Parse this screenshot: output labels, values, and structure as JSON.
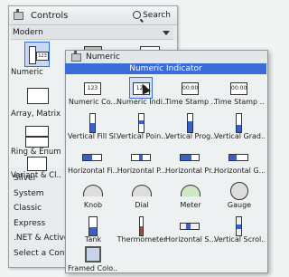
{
  "controls_palette": {
    "title": "Controls",
    "search_label": "Search",
    "category": "Modern",
    "items": [
      {
        "label": "Numeric",
        "icon": "numeric-icon"
      },
      {
        "label": "",
        "icon": "boolean-icon"
      },
      {
        "label": "",
        "icon": "string-icon"
      },
      {
        "label": "Array, Matrix...",
        "icon": "array-icon"
      },
      {
        "label": "Ring & Enum",
        "icon": "ring-icon"
      },
      {
        "label": "Variant & Cl...",
        "icon": "variant-icon"
      }
    ],
    "sub_palettes": [
      "Silver",
      "System",
      "Classic",
      "Express",
      ".NET & ActiveX",
      "Select a Contro"
    ]
  },
  "numeric_palette": {
    "title": "Numeric",
    "tooltip": "Numeric Indicator",
    "items": [
      "Numeric Co...",
      "Numeric Indi...",
      "Time Stamp ...",
      "Time Stamp ...",
      "Vertical Fill Sl...",
      "Vertical Poin...",
      "Vertical Prog...",
      "Vertical Grad...",
      "Horizontal Fi...",
      "Horizontal P...",
      "Horizontal Pr...",
      "Horizontal G...",
      "Knob",
      "Dial",
      "Meter",
      "Gauge",
      "Tank",
      "Thermometer",
      "Horizontal S...",
      "Vertical Scrol...",
      "Framed Colo..."
    ],
    "digits": "123",
    "timestamp": "00:00"
  }
}
